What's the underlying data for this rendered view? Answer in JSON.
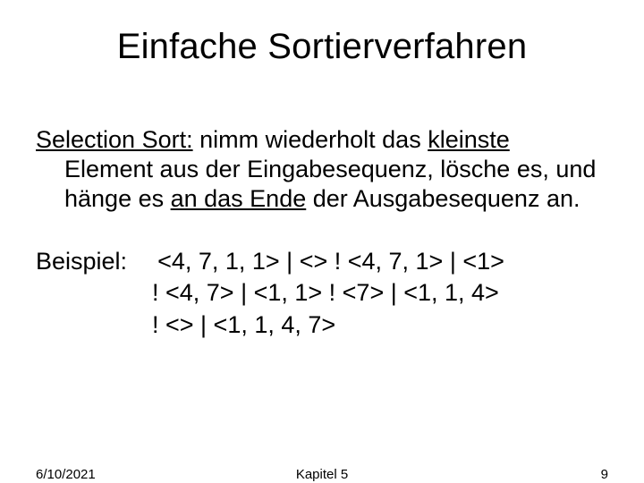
{
  "title": "Einfache Sortierverfahren",
  "description": {
    "lead": "Selection Sort:",
    "rest_line1": " nimm wiederholt das ",
    "kw1": "kleinste",
    "rest_line2": "Element aus der Eingabesequenz, lösche es, und hänge es ",
    "kw2": "an das Ende",
    "rest_line3": " der Ausgabesequenz an."
  },
  "example": {
    "label": "Beispiel:",
    "line1": "<4, 7, 1, 1> | <>  !  <4, 7, 1> | <1>",
    "line2": "! <4, 7> | <1, 1>   !  <7> | <1, 1, 4>",
    "line3": "! <> | <1, 1, 4, 7>"
  },
  "footer": {
    "date": "6/10/2021",
    "chapter": "Kapitel 5",
    "page": "9"
  }
}
